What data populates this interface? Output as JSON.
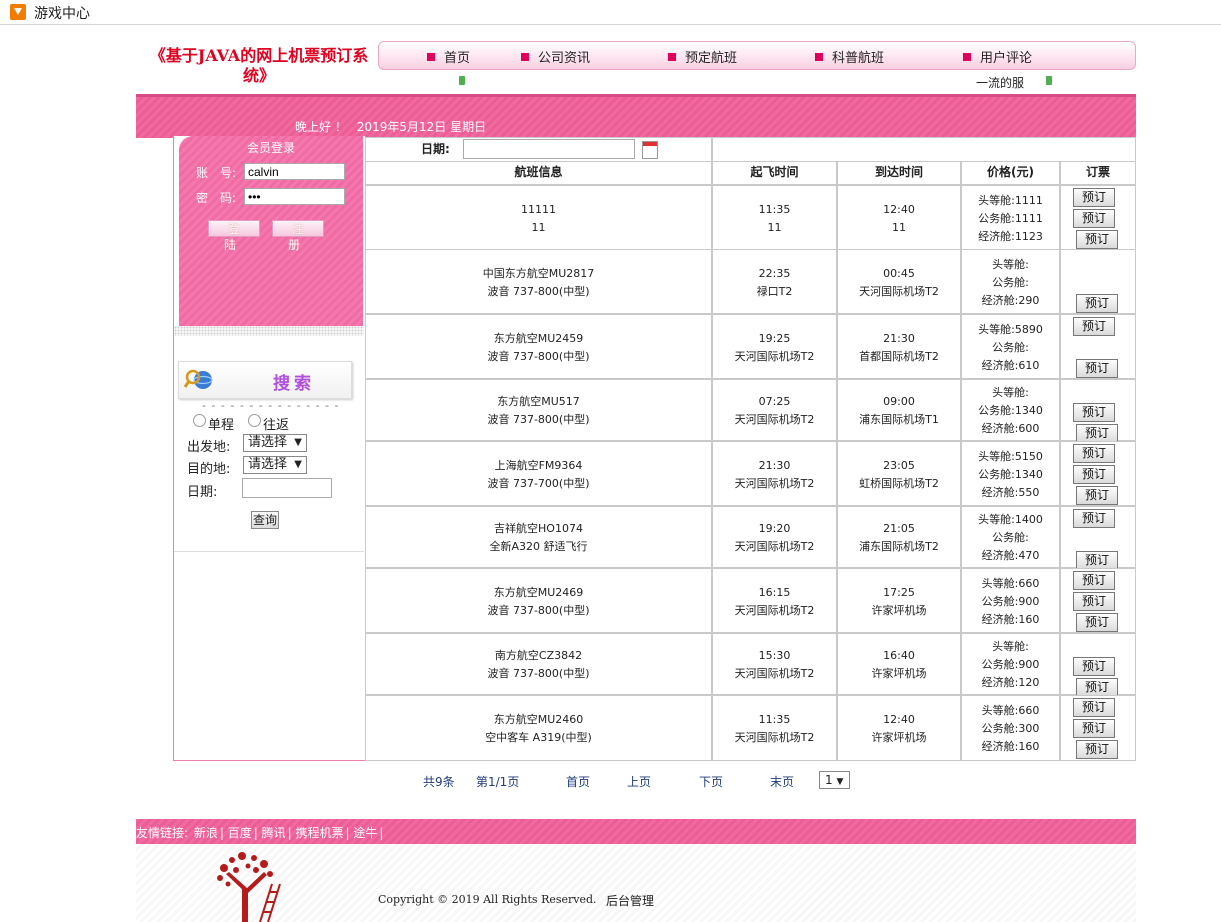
{
  "browser_tab": {
    "title": "游戏中心"
  },
  "header": {
    "site_title_line1": "《基于JAVA的网上机票预订系",
    "site_title_line2": "统》",
    "nav": [
      "首页",
      "公司资讯",
      "预定航班",
      "科普航班",
      "用户评论"
    ],
    "marquee": "一流的服"
  },
  "greeting": {
    "text": "晚上好 ！",
    "date": "2019年5月12日 星期日"
  },
  "login": {
    "title": "会员登录",
    "account_label": "账　号:",
    "account_value": "calvin",
    "password_label": "密　码:",
    "password_value": "•••",
    "login_button": "登 陆",
    "register_button": "注 册"
  },
  "search": {
    "title": "搜索",
    "dashes": "- - - - - - - - - - - - - - -",
    "trip_one_way": "单程",
    "trip_round": "往返",
    "from_label": "出发地:",
    "from_value": "请选择",
    "to_label": "目的地:",
    "to_value": "请选择",
    "date_label": "日期:",
    "date_value": "",
    "query_button": "查询"
  },
  "table": {
    "date_label": "日期:",
    "date_value": "",
    "columns": [
      "航班信息",
      "起飞时间",
      "到达时间",
      "价格(元)",
      "订票"
    ],
    "book_label": "预订",
    "rows": [
      {
        "flight": "11111",
        "plane": "11",
        "dep_time": "11:35",
        "dep_airport": "11",
        "arr_time": "12:40",
        "arr_airport": "11",
        "first": "头等舱:1111",
        "business": "公务舱:1111",
        "economy": "经济舱:1123"
      },
      {
        "flight": "中国东方航空MU2817",
        "plane": "波音 737-800(中型)",
        "dep_time": "22:35",
        "dep_airport": "禄口T2",
        "arr_time": "00:45",
        "arr_airport": "天河国际机场T2",
        "first": "头等舱:",
        "business": "公务舱:",
        "economy": "经济舱:290"
      },
      {
        "flight": "东方航空MU2459",
        "plane": "波音 737-800(中型)",
        "dep_time": "19:25",
        "dep_airport": "天河国际机场T2",
        "arr_time": "21:30",
        "arr_airport": "首都国际机场T2",
        "first": "头等舱:5890",
        "business": "公务舱:",
        "economy": "经济舱:610"
      },
      {
        "flight": "东方航空MU517",
        "plane": "波音 737-800(中型)",
        "dep_time": "07:25",
        "dep_airport": "天河国际机场T2",
        "arr_time": "09:00",
        "arr_airport": "浦东国际机场T1",
        "first": "头等舱:",
        "business": "公务舱:1340",
        "economy": "经济舱:600"
      },
      {
        "flight": "上海航空FM9364",
        "plane": "波音 737-700(中型)",
        "dep_time": "21:30",
        "dep_airport": "天河国际机场T2",
        "arr_time": "23:05",
        "arr_airport": "虹桥国际机场T2",
        "first": "头等舱:5150",
        "business": "公务舱:1340",
        "economy": "经济舱:550"
      },
      {
        "flight": "吉祥航空HO1074",
        "plane": "全新A320 舒适飞行",
        "dep_time": "19:20",
        "dep_airport": "天河国际机场T2",
        "arr_time": "21:05",
        "arr_airport": "浦东国际机场T2",
        "first": "头等舱:1400",
        "business": "公务舱:",
        "economy": "经济舱:470"
      },
      {
        "flight": "东方航空MU2469",
        "plane": "波音 737-800(中型)",
        "dep_time": "16:15",
        "dep_airport": "天河国际机场T2",
        "arr_time": "17:25",
        "arr_airport": "许家坪机场",
        "first": "头等舱:660",
        "business": "公务舱:900",
        "economy": "经济舱:160"
      },
      {
        "flight": "南方航空CZ3842",
        "plane": "波音 737-800(中型)",
        "dep_time": "15:30",
        "dep_airport": "天河国际机场T2",
        "arr_time": "16:40",
        "arr_airport": "许家坪机场",
        "first": "头等舱:",
        "business": "公务舱:900",
        "economy": "经济舱:120"
      },
      {
        "flight": "东方航空MU2460",
        "plane": "空中客车 A319(中型)",
        "dep_time": "11:35",
        "dep_airport": "天河国际机场T2",
        "arr_time": "12:40",
        "arr_airport": "许家坪机场",
        "first": "头等舱:660",
        "business": "公务舱:300",
        "economy": "经济舱:160"
      }
    ]
  },
  "pagination": {
    "total": "共9条",
    "page_info": "第1/1页",
    "first": "首页",
    "prev": "上页",
    "next": "下页",
    "last": "末页",
    "current": "1"
  },
  "footer": {
    "links_label": "友情链接:",
    "links": [
      "新浪",
      "百度",
      "腾讯",
      "携程机票",
      "途牛"
    ],
    "copyright": "Copyright © 2019 All Rights Reserved.",
    "admin_link": "后台管理"
  },
  "colors": {
    "brand_pink": "#ec5d96",
    "title_red": "#e00020",
    "nav_square": "#e0005a",
    "pager_blue": "#1f3b7a"
  }
}
